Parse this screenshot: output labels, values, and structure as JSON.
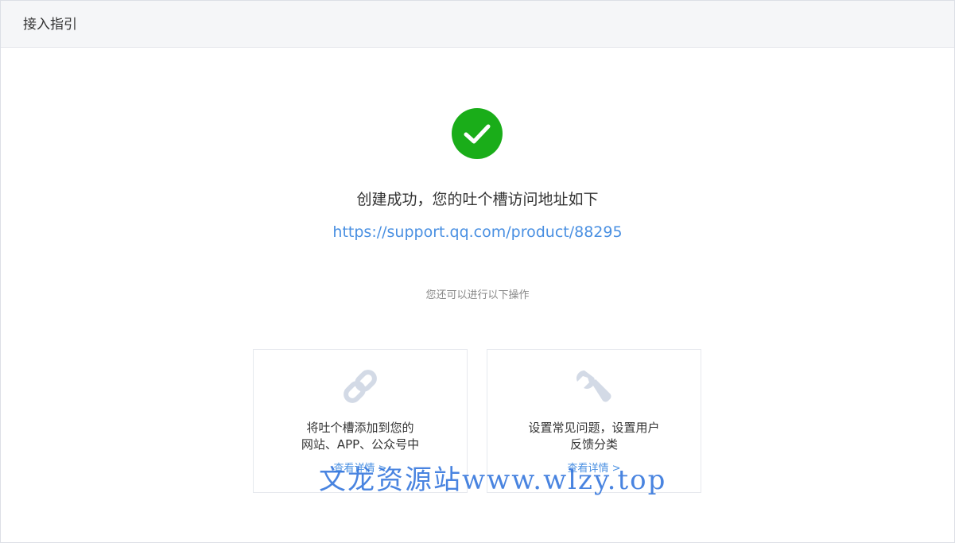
{
  "header": {
    "title": "接入指引"
  },
  "success": {
    "title": "创建成功，您的吐个槽访问地址如下",
    "url": "https://support.qq.com/product/88295",
    "icon": "check-circle-icon"
  },
  "hint": "您还可以进行以下操作",
  "cards": [
    {
      "icon": "link-icon",
      "line1": "将吐个槽添加到您的",
      "line2": "网站、APP、公众号中",
      "link": "查看详情 >"
    },
    {
      "icon": "wrench-icon",
      "line1": "设置常见问题，设置用户",
      "line2": "反馈分类",
      "link": "查看详情 >"
    }
  ],
  "watermark": "文龙资源站www.wlzy.top",
  "colors": {
    "success_green": "#1aad19",
    "link_blue": "#4a90e2",
    "icon_gray": "#d3dae6"
  }
}
